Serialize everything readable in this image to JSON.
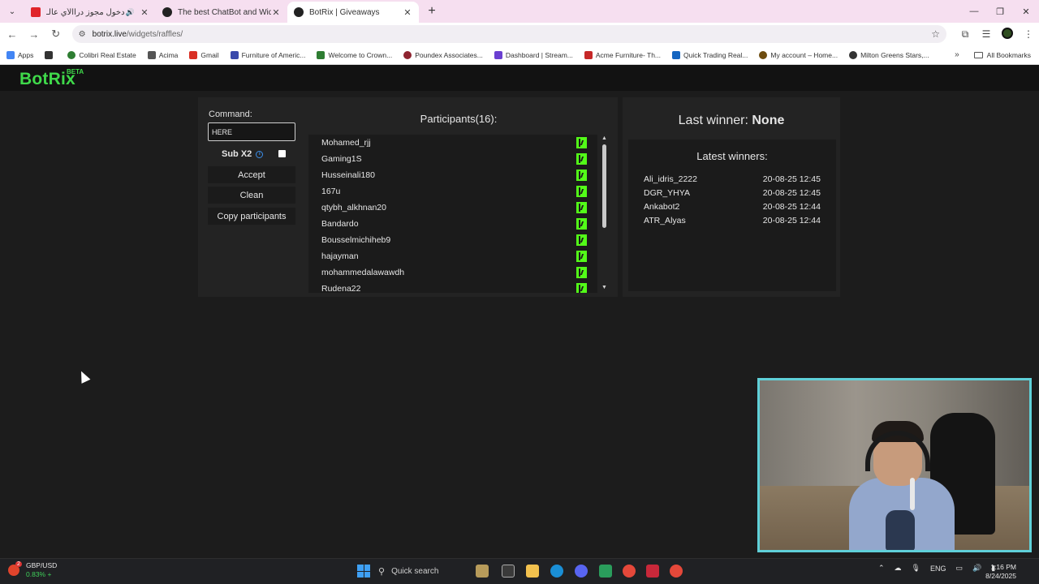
{
  "browser": {
    "tabs": [
      {
        "title": "اقوى دخول مجوز دراالأي عالـ",
        "favicon_color": "#e0242a",
        "has_audio": true,
        "active": false
      },
      {
        "title": "The best ChatBot and Widgets",
        "favicon_color": "#222222",
        "active": false
      },
      {
        "title": "BotRix | Giveaways",
        "favicon_color": "#222222",
        "active": true
      }
    ],
    "url_host": "botrix.live",
    "url_path": "/widgets/raffles/",
    "bookmarks": [
      {
        "label": "Apps",
        "color": "#4285f4"
      },
      {
        "label": "Colibri Real Estate",
        "color": "#2e7d32"
      },
      {
        "label": "Acima",
        "color": "#555555"
      },
      {
        "label": "Gmail",
        "color": "#d93025"
      },
      {
        "label": "Furniture of Americ...",
        "color": "#3949ab"
      },
      {
        "label": "Welcome to Crown...",
        "color": "#2e7d32"
      },
      {
        "label": "Poundex Associates...",
        "color": "#8e2430"
      },
      {
        "label": "Dashboard | Stream...",
        "color": "#6a3fd1"
      },
      {
        "label": "Acme Furniture- Th...",
        "color": "#c62828"
      },
      {
        "label": "Quick Trading Real...",
        "color": "#1565c0"
      },
      {
        "label": "My account – Home...",
        "color": "#6d4c0f"
      },
      {
        "label": "Milton Greens Stars,...",
        "color": "#333333"
      }
    ],
    "all_bookmarks": "All Bookmarks"
  },
  "app": {
    "logo": "BotRix",
    "logo_badge": "BETA",
    "accent": "#3fd94a"
  },
  "raffle": {
    "command_label": "Command:",
    "command_value": "HERE",
    "sub_label": "Sub X2",
    "accept": "Accept",
    "clean": "Clean",
    "copy": "Copy participants",
    "participants_title": "Participants(16):",
    "participants": [
      "Mohamed_rjj",
      "Gaming1S",
      "Husseinali180",
      "167u",
      "qtybh_alkhnan20",
      "Bandardo",
      "Bousselmichiheb9",
      "hajayman",
      "mohammedalawawdh",
      "Rudena22"
    ],
    "platform_color": "#53fc18"
  },
  "winners": {
    "last_label": "Last winner:",
    "last_value": "None",
    "latest_title": "Latest winners:",
    "list": [
      {
        "name": "Ali_idris_2222",
        "time": "20-08-25 12:45"
      },
      {
        "name": "DGR_YHYA",
        "time": "20-08-25 12:45"
      },
      {
        "name": "Ankabot2",
        "time": "20-08-25 12:44"
      },
      {
        "name": "ATR_Alyas",
        "time": "20-08-25 12:44"
      }
    ]
  },
  "taskbar": {
    "ticker": "GBP/USD",
    "ticker_change": "0.83% +",
    "badge": "2",
    "search": "Quick search",
    "lang": "ENG",
    "time": "1:16 PM",
    "date": "8/24/2025"
  }
}
